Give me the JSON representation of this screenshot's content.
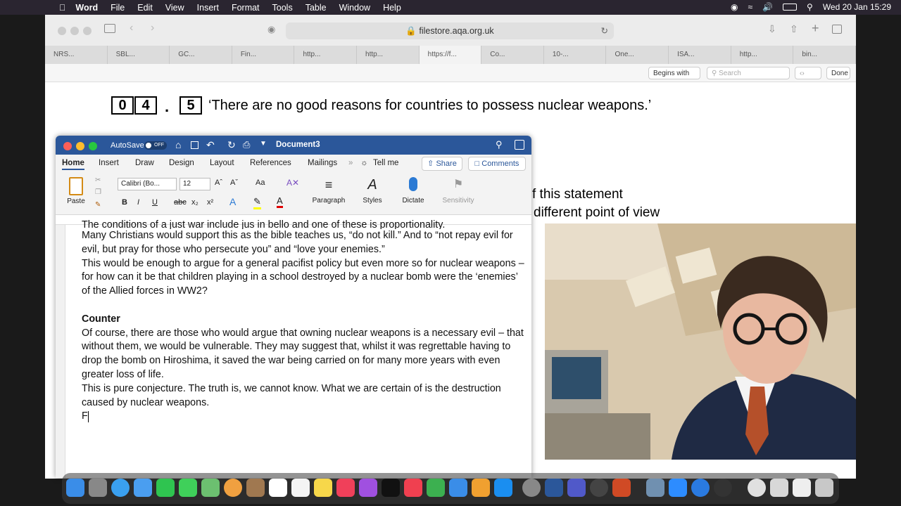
{
  "menubar": {
    "app_name": "Word",
    "items": [
      "File",
      "Edit",
      "View",
      "Insert",
      "Format",
      "Tools",
      "Table",
      "Window",
      "Help"
    ],
    "datetime": "Wed 20 Jan  15:29"
  },
  "safari": {
    "url": "filestore.aqa.org.uk",
    "tabs": [
      "NRS...",
      "SBL...",
      "GC...",
      "Fin...",
      "http...",
      "http...",
      "https://f...",
      "Co...",
      "10-...",
      "One...",
      "ISA...",
      "http...",
      "bin..."
    ],
    "find": {
      "mode": "Begins with",
      "search_placeholder": "Search",
      "done_label": "Done"
    }
  },
  "pdf": {
    "question_digits": [
      "0",
      "4",
      "5"
    ],
    "question_dot": ".",
    "question_text": "‘There are no good reasons for countries to possess nuclear weapons.’",
    "partial_line_1": "f this statement",
    "partial_line_2": "different point of view"
  },
  "word": {
    "autosave_label": "AutoSave",
    "autosave_state": "OFF",
    "doc_title": "Document3",
    "tabs": [
      "Home",
      "Insert",
      "Draw",
      "Design",
      "Layout",
      "References",
      "Mailings"
    ],
    "tell_me": "Tell me",
    "share_label": "Share",
    "comments_label": "Comments",
    "font_name": "Calibri (Bo...",
    "font_size": "12",
    "ribbon_labels": {
      "paste": "Paste",
      "paragraph": "Paragraph",
      "styles": "Styles",
      "dictate": "Dictate",
      "sensitivity": "Sensitivity"
    },
    "body": {
      "partial_top": "The conditions of a just war include jus in bello and one of these is proportionality.",
      "p1": "Many Christians would support this as the bible teaches us, “do not kill.” And to “not repay evil for evil, but pray for those who persecute you” and “love your enemies.”",
      "p2": "This would be enough to argue for a general pacifist policy but even more so for nuclear weapons – for how can it be that children playing in a school destroyed by a nuclear bomb were the ‘enemies’ of the Allied forces in WW2?",
      "heading": "Counter",
      "p3": "Of course, there are those who would argue that owning nuclear weapons is a necessary evil – that without them, we would be vulnerable.  They may suggest that, whilst it was regrettable having to drop the bomb on Hiroshima, it saved the war being carried on for many more years with even greater loss of life.",
      "p4": "This is pure conjecture.  The truth is, we cannot know.  What we are certain of is the destruction caused by nuclear weapons.",
      "p5": "F"
    }
  },
  "colors": {
    "word_blue": "#2b579a",
    "menubar": "#2a2530"
  }
}
